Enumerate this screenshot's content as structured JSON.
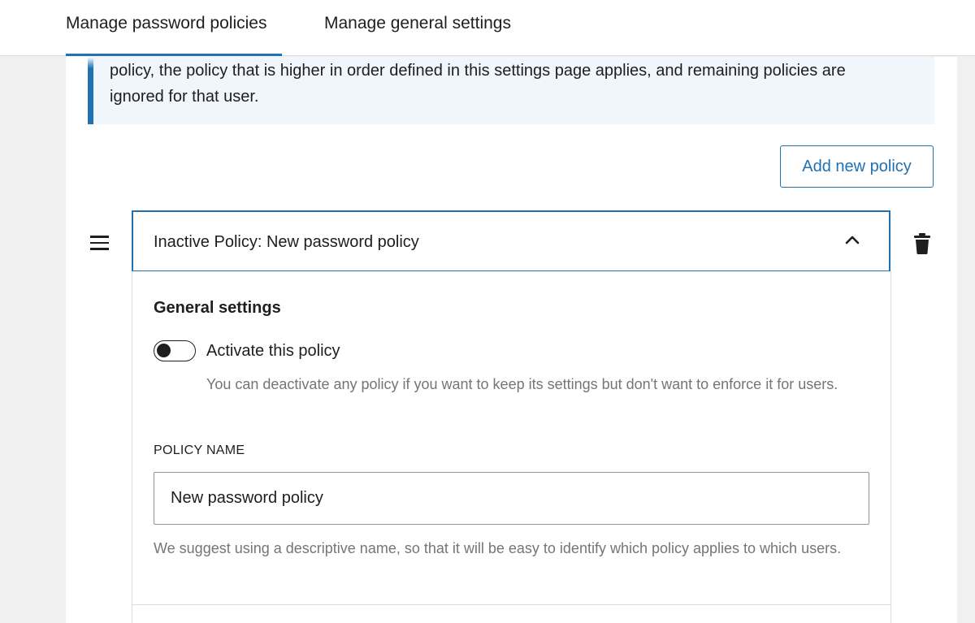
{
  "tabs": [
    {
      "label": "Manage password policies",
      "active": true
    },
    {
      "label": "Manage general settings",
      "active": false
    }
  ],
  "notice": {
    "text": "policy, the policy that is higher in order defined in this settings page applies, and remaining policies are ignored for that user."
  },
  "add_policy_button": {
    "label": "Add new policy"
  },
  "policy": {
    "title": "Inactive Policy: New password policy",
    "expanded": true,
    "general_settings_heading": "General settings",
    "activate_toggle": {
      "label": "Activate this policy",
      "checked": false,
      "help": "You can deactivate any policy if you want to keep its settings but don't want to enforce it for users."
    },
    "name_field": {
      "label": "POLICY NAME",
      "value": "New password policy",
      "help": "We suggest using a descriptive name, so that it will be easy to identify which policy applies to which users."
    }
  },
  "icons": {
    "drag": "drag-handle-icon",
    "chevron": "chevron-up-icon",
    "trash": "trash-icon"
  },
  "colors": {
    "accent": "#2271b1",
    "notice_bg": "#f0f6fc",
    "help_text": "#757575"
  }
}
